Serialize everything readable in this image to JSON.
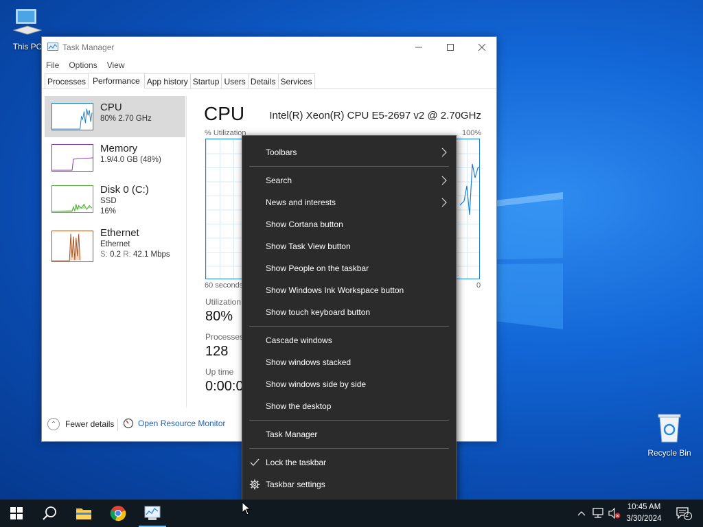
{
  "desktop": {
    "this_pc_label": "This PC",
    "recycle_bin_label": "Recycle Bin"
  },
  "task_manager": {
    "title": "Task Manager",
    "menu": [
      "File",
      "Options",
      "View"
    ],
    "tabs": [
      "Processes",
      "Performance",
      "App history",
      "Startup",
      "Users",
      "Details",
      "Services"
    ],
    "active_tab": "Performance",
    "resources": [
      {
        "name": "CPU",
        "line1": "80%  2.70 GHz",
        "line2": "",
        "color": "#1a7fd4"
      },
      {
        "name": "Memory",
        "line1": "1.9/4.0 GB (48%)",
        "line2": "",
        "color": "#8b30a8"
      },
      {
        "name": "Disk 0 (C:)",
        "line1": "SSD",
        "line2": "16%",
        "color": "#4ba82e"
      },
      {
        "name": "Ethernet",
        "line1": "Ethernet",
        "line2_s_label": "S:",
        "line2_s": "0.2",
        "line2_r_label": "R:",
        "line2_r": "42.1 Mbps",
        "color": "#a8501a"
      }
    ],
    "detail": {
      "heading": "CPU",
      "model": "Intel(R) Xeon(R) CPU E5-2697 v2 @ 2.70GHz",
      "graph_label_left": "% Utilization",
      "graph_label_right": "100%",
      "graph_time_label": "60 seconds",
      "graph_zero_label": "0",
      "utilization_label": "Utilization",
      "utilization_value": "80%",
      "processes_label": "Processes",
      "processes_value": "128",
      "uptime_label": "Up time",
      "uptime_value": "0:00:0"
    },
    "footer": {
      "fewer_details": "Fewer details",
      "open_resource_monitor": "Open Resource Monitor"
    }
  },
  "context_menu": {
    "toolbars": "Toolbars",
    "search": "Search",
    "news_and_interests": "News and interests",
    "show_cortana": "Show Cortana button",
    "show_task_view": "Show Task View button",
    "show_people": "Show People on the taskbar",
    "show_ink": "Show Windows Ink Workspace button",
    "show_touch_keyboard": "Show touch keyboard button",
    "cascade": "Cascade windows",
    "stacked": "Show windows stacked",
    "side_by_side": "Show windows side by side",
    "show_desktop": "Show the desktop",
    "task_manager": "Task Manager",
    "lock_taskbar": "Lock the taskbar",
    "taskbar_settings": "Taskbar settings"
  },
  "taskbar": {
    "time": "10:45 AM",
    "date": "3/30/2024",
    "notification_count": "2",
    "accent": "#76b9ed"
  }
}
